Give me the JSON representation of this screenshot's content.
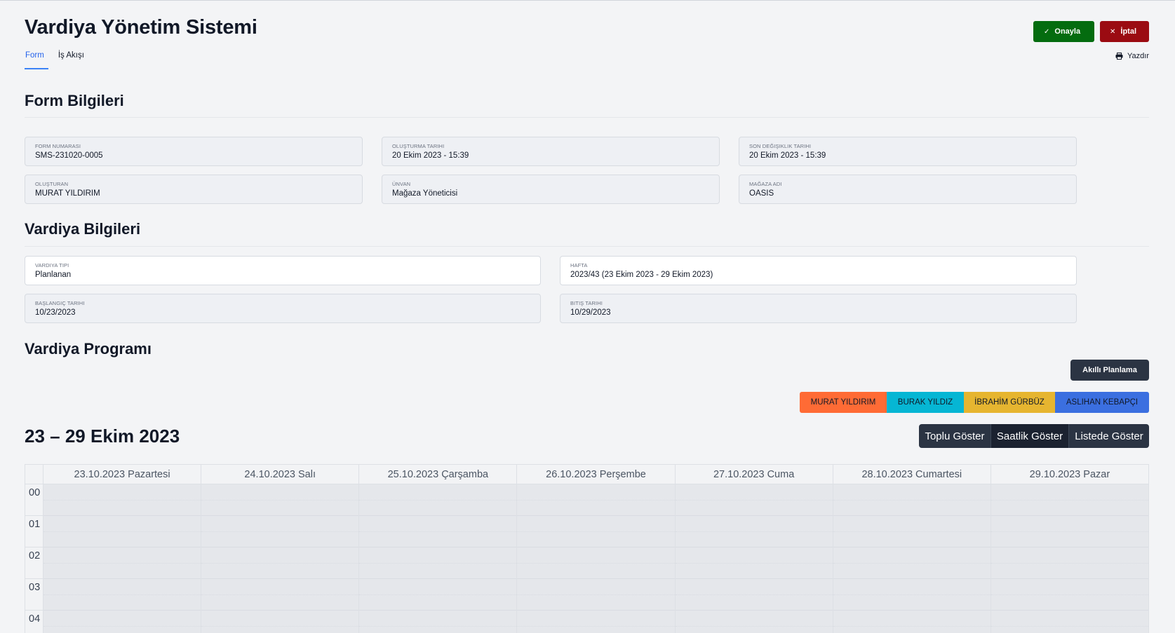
{
  "app": {
    "title": "Vardiya Yönetim Sistemi"
  },
  "tabs": [
    {
      "label": "Form",
      "active": true
    },
    {
      "label": "İş Akışı",
      "active": false
    }
  ],
  "actions": {
    "approve_label": "Onayla",
    "cancel_label": "İptal",
    "print_label": "Yazdır"
  },
  "form_info": {
    "title": "Form Bilgileri",
    "fields": [
      {
        "label": "FORM NUMARASI",
        "value": "SMS-231020-0005"
      },
      {
        "label": "OLUŞTURMA TARIHI",
        "value": "20 Ekim 2023 - 15:39"
      },
      {
        "label": "SON DEĞIŞIKLIK TARIHI",
        "value": "20 Ekim 2023 - 15:39"
      },
      {
        "label": "OLUŞTURAN",
        "value": "MURAT YILDIRIM"
      },
      {
        "label": "ÜNVAN",
        "value": "Mağaza Yöneticisi"
      },
      {
        "label": "MAĞAZA ADI",
        "value": "OASIS"
      }
    ]
  },
  "shift_info": {
    "title": "Vardiya Bilgileri",
    "fields": [
      {
        "label": "VARDIYA TIPI",
        "value": "Planlanan"
      },
      {
        "label": "HAFTA",
        "value": "2023/43 (23 Ekim 2023 - 29 Ekim 2023)"
      },
      {
        "label": "BAŞLANGIÇ TARIHI",
        "value": "10/23/2023"
      },
      {
        "label": "BITIŞ TARIHI",
        "value": "10/29/2023"
      }
    ]
  },
  "program": {
    "title": "Vardiya Programı",
    "smart_plan_label": "Akıllı Planlama",
    "employees": [
      {
        "name": "MURAT YILDIRIM",
        "color": "#ff6b35"
      },
      {
        "name": "BURAK YILDIZ",
        "color": "#06b6d4"
      },
      {
        "name": "İBRAHİM GÜRBÜZ",
        "color": "#e6b530"
      },
      {
        "name": "ASLIHAN KEBAPÇI",
        "color": "#3b6fe0"
      }
    ],
    "range_title": "23 – 29 Ekim 2023",
    "views": [
      {
        "label": "Toplu Göster",
        "active": false
      },
      {
        "label": "Saatlik Göster",
        "active": true
      },
      {
        "label": "Listede Göster",
        "active": false
      }
    ],
    "days": [
      "23.10.2023 Pazartesi",
      "24.10.2023 Salı",
      "25.10.2023 Çarşamba",
      "26.10.2023 Perşembe",
      "27.10.2023 Cuma",
      "28.10.2023 Cumartesi",
      "29.10.2023 Pazar"
    ],
    "hours": [
      "00",
      "01",
      "02",
      "03",
      "04"
    ]
  },
  "colors": {
    "approve": "#046c0f",
    "cancel": "#9b0b12",
    "dark_button": "#2b3443",
    "accent": "#2563eb"
  }
}
